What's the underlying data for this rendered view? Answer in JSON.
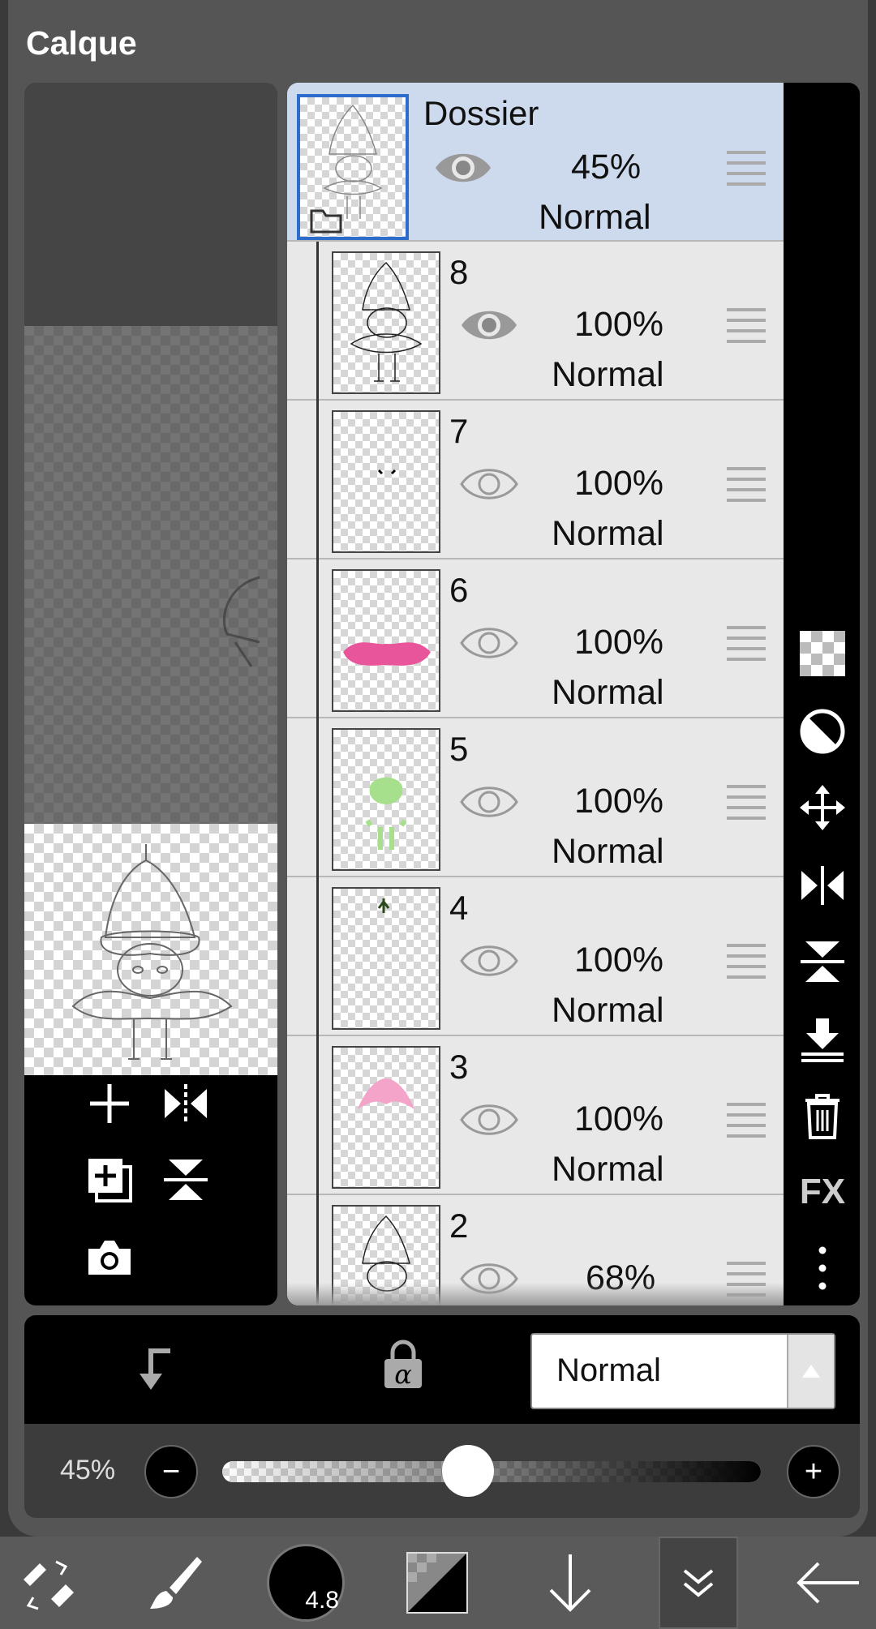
{
  "dialog": {
    "title": "Calque"
  },
  "layers": [
    {
      "name": "Dossier",
      "opacity": "45%",
      "blend": "Normal",
      "visible": true,
      "selected": true,
      "type": "folder"
    },
    {
      "name": "8",
      "opacity": "100%",
      "blend": "Normal",
      "visible": true,
      "selected": false,
      "type": "layer"
    },
    {
      "name": "7",
      "opacity": "100%",
      "blend": "Normal",
      "visible": false,
      "selected": false,
      "type": "layer"
    },
    {
      "name": "6",
      "opacity": "100%",
      "blend": "Normal",
      "visible": false,
      "selected": false,
      "type": "layer"
    },
    {
      "name": "5",
      "opacity": "100%",
      "blend": "Normal",
      "visible": false,
      "selected": false,
      "type": "layer"
    },
    {
      "name": "4",
      "opacity": "100%",
      "blend": "Normal",
      "visible": false,
      "selected": false,
      "type": "layer"
    },
    {
      "name": "3",
      "opacity": "100%",
      "blend": "Normal",
      "visible": false,
      "selected": false,
      "type": "layer"
    },
    {
      "name": "2",
      "opacity": "68%",
      "blend": "",
      "visible": false,
      "selected": false,
      "type": "layer"
    }
  ],
  "sidebar": {
    "fx_label": "FX",
    "icons": [
      "transparency-icon",
      "clip-icon",
      "move-icon",
      "flip-horizontal-icon",
      "flip-vertical-icon",
      "merge-down-icon",
      "trash-icon",
      "fx-icon",
      "more-icon"
    ]
  },
  "blend_bar": {
    "blend_mode": "Normal"
  },
  "opacity_bar": {
    "label": "45%",
    "value": 0.45,
    "minus": "−",
    "plus": "+"
  },
  "toolbar": {
    "brush_size": "4.8"
  },
  "colors": {
    "selected_row": "#cdd9ec",
    "selection_border": "#2e6ccc",
    "pink": "#e8559a",
    "light_pink": "#f4a3c9",
    "green": "#a6e08c"
  }
}
